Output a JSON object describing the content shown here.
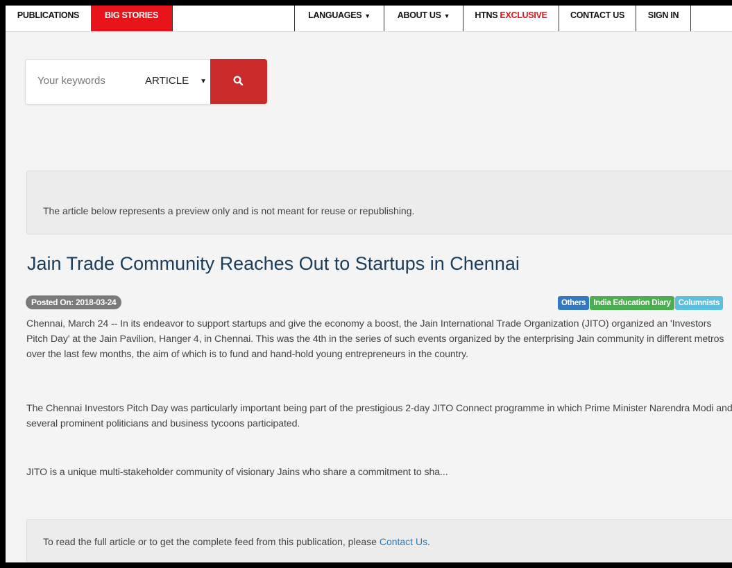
{
  "nav": {
    "publications": "PUBLICATIONS",
    "big_stories": "BIG STORIES",
    "languages": "LANGUAGES",
    "about_us": "ABOUT US",
    "htns": "HTNS",
    "exclusive": "EXCLUSIVE",
    "contact_us": "CONTACT US",
    "sign_in": "SIGN IN"
  },
  "search": {
    "placeholder": "Your keywords",
    "type_selected": "ARTICLE",
    "button_icon": "search-icon"
  },
  "notice_top": "The article below represents a preview only and is not meant for reuse or republishing.",
  "article": {
    "title": "Jain Trade Community Reaches Out to Startups in Chennai",
    "posted": "Posted On: 2018-03-24",
    "tags": [
      {
        "label": "Others",
        "color": "#3478c0"
      },
      {
        "label": "India Education Diary",
        "color": "#4bae4f"
      },
      {
        "label": "Columnists",
        "color": "#5bc0de"
      }
    ],
    "paragraphs": [
      "Chennai, March 24 -- In its endeavor to support startups and give the economy a boost, the Jain International Trade Organization (JITO) organized an 'Investors Pitch Day' at the Jain Pavilion, Hanger 4, in Chennai. This was the 4th in the series of such events organized by the enterprising Jain community in different metros over the last few months, the aim of which is to fund and hand-hold young entrepreneurs in the country.",
      "The Chennai Investors Pitch Day was particularly important being part of the prestigious 2-day JITO Connect programme in which Prime Minister Narendra Modi and several prominent politicians and business tycoons participated.",
      "JITO is a unique multi-stakeholder community of visionary Jains who share a commitment to sha..."
    ]
  },
  "notice_bottom": {
    "text": "To read the full article or to get the complete feed from this publication, please",
    "link": "Contact Us",
    "end": "."
  },
  "colors": {
    "accent_red": "#e8141a",
    "search_button": "#c92a2a",
    "title": "#1a3d5c",
    "link": "#2a7ab0"
  }
}
